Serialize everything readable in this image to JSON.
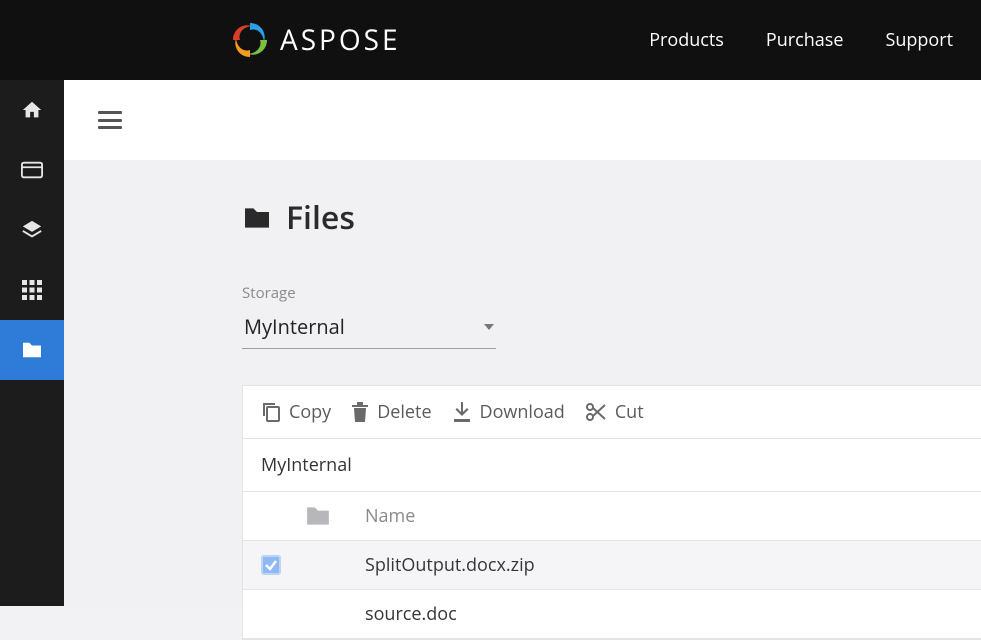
{
  "brand": {
    "name": "ASPOSE"
  },
  "topnav": {
    "products": "Products",
    "purchase": "Purchase",
    "support": "Support"
  },
  "page": {
    "title": "Files"
  },
  "storage": {
    "label": "Storage",
    "selected": "MyInternal"
  },
  "toolbar": {
    "copy": "Copy",
    "delete": "Delete",
    "download": "Download",
    "cut": "Cut"
  },
  "files": {
    "breadcrumb": "MyInternal",
    "columns": {
      "name": "Name"
    },
    "rows": [
      {
        "name": "SplitOutput.docx.zip",
        "selected": true
      },
      {
        "name": "source.doc",
        "selected": false
      }
    ]
  }
}
